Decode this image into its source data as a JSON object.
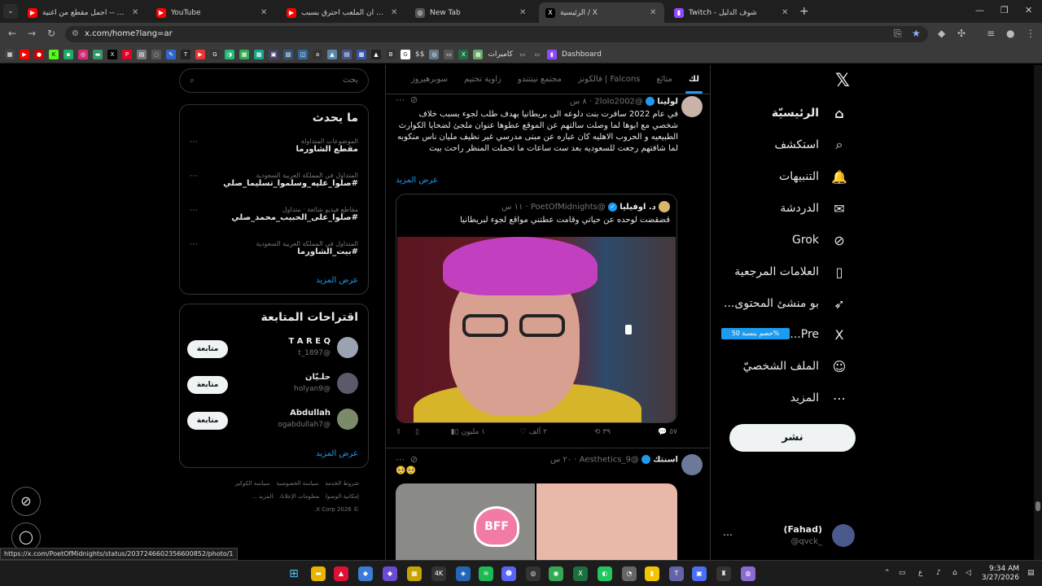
{
  "browser": {
    "tabs": [
      {
        "title": "أم كلثوم -- أجمل مقطع من أغنية",
        "fav": "▶",
        "color": "#ff0000"
      },
      {
        "title": "YouTube",
        "fav": "▶",
        "color": "#ff0000"
      },
      {
        "title": "يتقنعني ان الملعب احترق بسبب",
        "fav": "▶",
        "color": "#ff0000"
      },
      {
        "title": "New Tab",
        "fav": "◎",
        "color": "#555555"
      },
      {
        "title": "الرئيسية / X",
        "fav": "X",
        "color": "#000000"
      },
      {
        "title": "Twitch - شوف الدليل",
        "fav": "▮",
        "color": "#9146ff"
      }
    ],
    "url": "x.com/home?lang=ar",
    "bookmark_labels": [
      "كاميرات",
      "Dashboard"
    ],
    "status_url": "https://x.com/PoetOfMidnights/status/2037246602356600852/photo/1"
  },
  "nav": {
    "items": [
      {
        "label": "الرئيسيّة",
        "icon": "home-icon",
        "glyph": "⌂"
      },
      {
        "label": "استكشف",
        "icon": "search-icon",
        "glyph": "⌕"
      },
      {
        "label": "التنبيهات",
        "icon": "bell-icon",
        "glyph": "🔔"
      },
      {
        "label": "الدردشة",
        "icon": "mail-icon",
        "glyph": "✉"
      },
      {
        "label": "Grok",
        "icon": "grok-icon",
        "glyph": "⊘"
      },
      {
        "label": "العلامات المرجعية",
        "icon": "bookmark-icon",
        "glyph": "▯"
      },
      {
        "label": "...بو منشئ المحتوى",
        "icon": "rocket-icon",
        "glyph": "➶"
      },
      {
        "label": "...Pre",
        "icon": "x-premium-icon",
        "glyph": "X"
      },
      {
        "label": "الملف الشخصيّ",
        "icon": "person-icon",
        "glyph": "☺"
      },
      {
        "label": "المزيد",
        "icon": "more-icon",
        "glyph": "⋯"
      }
    ],
    "premium_badge": "خصم بنسبة 50%",
    "post_button": "نشر",
    "me": {
      "name": "(Fahad)",
      "handle": "@qvck_"
    }
  },
  "timeline": {
    "tabs": [
      "لك",
      "متابَع",
      "فالكونز | Falcons",
      "مجتمع نينتندو",
      "زاوية تختيم",
      "سوبرهيروز"
    ],
    "tweet1": {
      "name": "لولينا",
      "handle": "@2lolo2002",
      "time": "٨ س",
      "text": "في عام 2022 سافرت بنت دلوعه الى بريطانيا بهدف طلب لجوء بسبب خلاف شخصي مع ابوها لما وصلت سالتهم عن الموقع عطوها عنوان ملجئ لضحايا الكوارث الطبيعيه و الحروب الاهليه كان عباره عن مبنى مدرسي غير نظيف مليان ناس منكوبه لما شافتهم رجعت للسعوديه بعد ست ساعات ما تحملت المنظر راحت بيت",
      "more": "عرض المزيد",
      "quote": {
        "name": "د. اوفيليا",
        "handle": "@PoetOfMidnights",
        "time": "١١ س",
        "text": "قضقضت لوحده عن حياتي وقامت عطتني مواقع لجوء لبريطانيا"
      },
      "actions": {
        "replies": "٥٧",
        "reposts": "٣٩",
        "likes": "٢ ألف",
        "views": "١ مليون"
      }
    },
    "tweet2": {
      "name": "اسنتك",
      "handle": "@Aesthetics_9",
      "time": "٢٠ س",
      "text": "🥺🥺",
      "bff": "BFF"
    }
  },
  "sidebar": {
    "search_placeholder": "بحث",
    "trends_title": "ما يحدث",
    "trends": [
      {
        "context": "الموضوعات المتداولة",
        "title": "مقطع الشاورما"
      },
      {
        "context": "المتداول في المملكة العربية السعودية",
        "title": "#صلوا_عليه_وسلموا_تسليما_صلي"
      },
      {
        "context": "مقاطع فيديو شائعة · متداول",
        "title": "#صلوا_على_الحبيب_محمد_صلي"
      },
      {
        "context": "المتداول في المملكة العربية السعودية",
        "title": "#بيت_الشاورما"
      }
    ],
    "trends_more": "عرض المزيد",
    "who_title": "اقتراحات المتابعة",
    "suggestions": [
      {
        "name": "T A R E Q",
        "handle": "@t_1897",
        "color": "#9aa4b0"
      },
      {
        "name": "حلـيّان",
        "handle": "@holyan9",
        "color": "#5a5a6a"
      },
      {
        "name": "Abdullah",
        "handle": "@ogabdullah7",
        "color": "#7a8a6a"
      }
    ],
    "follow_label": "متابعة",
    "who_more": "عرض المزيد",
    "footer": [
      "شروط الخدمة",
      "سياسة الخصوصية",
      "سياسة الكوكيز",
      "إمكانية الوصول",
      "معلومات الإعلانات",
      "المزيد ...",
      "© 2026 X Corp."
    ]
  },
  "taskbar": {
    "time": "9:34 AM",
    "date": "3/27/2026",
    "lang": "ع"
  }
}
